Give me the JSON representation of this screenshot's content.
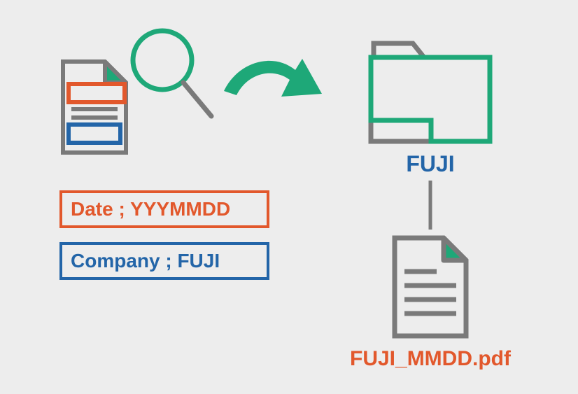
{
  "meta": {
    "date_label": "Date ; YYYMMDD",
    "company_label": "Company ; FUJI"
  },
  "output": {
    "folder_name": "FUJI",
    "file_name": "FUJI_MMDD.pdf"
  },
  "colors": {
    "orange": "#e2582c",
    "blue": "#2365a8",
    "green": "#1ea878",
    "gray": "#7a7a7a"
  }
}
